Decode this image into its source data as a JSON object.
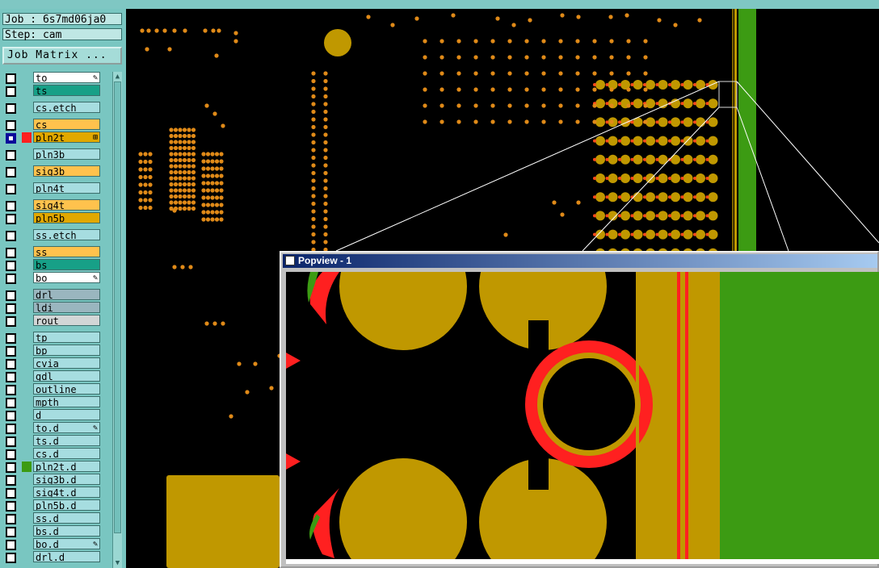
{
  "job": "Job : 6s7md06ja0",
  "step": "Step: cam",
  "job_matrix_label": "Job Matrix ...",
  "popup_title": "Popview - 1",
  "layers": [
    {
      "name": "to",
      "color": "#ffffff",
      "mark": "pen-icon"
    },
    {
      "name": "ts",
      "color": "#17a087"
    },
    {
      "name": "cs.etch",
      "color": "#a6dde0"
    },
    {
      "name": "cs",
      "color": "#ffc24d"
    },
    {
      "name": "pln2t",
      "color": "#e1a800",
      "selected": true,
      "swatch": "#ff2020",
      "mark": "grid-icon"
    },
    {
      "name": "pln3b",
      "color": "#a6dde0"
    },
    {
      "name": "sig3b",
      "color": "#ffc24d"
    },
    {
      "name": "pln4t",
      "color": "#a6dde0"
    },
    {
      "name": "sig4t",
      "color": "#ffc24d"
    },
    {
      "name": "pln5b",
      "color": "#e1a800"
    },
    {
      "name": "ss.etch",
      "color": "#a6dde0"
    },
    {
      "name": "ss",
      "color": "#ffc24d"
    },
    {
      "name": "bs",
      "color": "#17a087"
    },
    {
      "name": "bo",
      "color": "#ffffff",
      "mark": "pen-icon"
    },
    {
      "name": "drl",
      "color": "#9ab6bf"
    },
    {
      "name": "ldi",
      "color": "#9ab6bf"
    },
    {
      "name": "rout",
      "color": "#d2d6d6"
    },
    {
      "name": "tp",
      "color": "#a6dde0"
    },
    {
      "name": "bp",
      "color": "#a6dde0"
    },
    {
      "name": "cvia",
      "color": "#a6dde0"
    },
    {
      "name": "gdl",
      "color": "#a6dde0"
    },
    {
      "name": "outline",
      "color": "#a6dde0"
    },
    {
      "name": "mpth",
      "color": "#a6dde0"
    },
    {
      "name": "d",
      "color": "#a6dde0"
    },
    {
      "name": "to.d",
      "color": "#a6dde0",
      "mark": "pen-icon"
    },
    {
      "name": "ts.d",
      "color": "#a6dde0"
    },
    {
      "name": "cs.d",
      "color": "#a6dde0"
    },
    {
      "name": "pln2t.d",
      "color": "#a6dde0",
      "swatch": "#3c9b13"
    },
    {
      "name": "sig3b.d",
      "color": "#a6dde0"
    },
    {
      "name": "sig4t.d",
      "color": "#a6dde0"
    },
    {
      "name": "pln5b.d",
      "color": "#a6dde0"
    },
    {
      "name": "ss.d",
      "color": "#a6dde0"
    },
    {
      "name": "bs.d",
      "color": "#a6dde0"
    },
    {
      "name": "bo.d",
      "color": "#a6dde0",
      "mark": "pen-icon"
    },
    {
      "name": "drl.d",
      "color": "#a6dde0"
    }
  ],
  "colors": {
    "pad": "#c09800",
    "copper": "#c09800",
    "plane": "#3c9b13",
    "clearance": "#ff2020",
    "outline": "#e87a10"
  }
}
